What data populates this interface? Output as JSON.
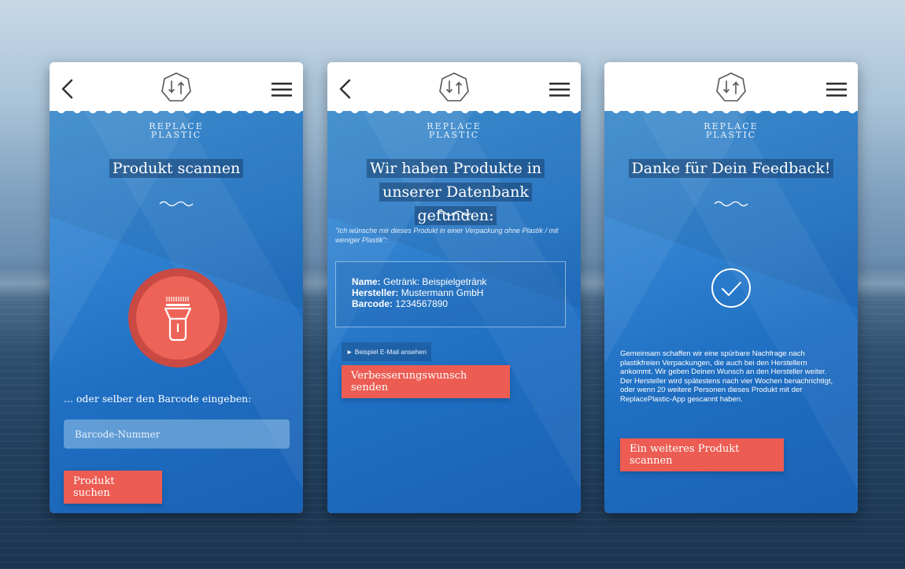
{
  "brand": {
    "line1": "REPLACE",
    "line2": "PLASTIC"
  },
  "screen1": {
    "title": "Produkt scannen",
    "alt_label": "... oder selber den Barcode eingeben:",
    "input_placeholder": "Barcode-Nummer",
    "button": "Produkt suchen"
  },
  "screen2": {
    "title": "Wir haben Produkte in unserer Datenbank gefunden:",
    "quote": "\"Ich wünsche mir dieses Produkt in einer Verpackung ohne Plastik / mit weniger Plastik\":",
    "product": {
      "name_label": "Name:",
      "name_value": "Getränk: Beispielgetränk",
      "maker_label": "Hersteller:",
      "maker_value": "Mustermann GmbH",
      "barcode_label": "Barcode:",
      "barcode_value": "1234567890"
    },
    "email_link": "► Beispiel E-Mail ansehen",
    "button": "Verbesserungswunsch senden"
  },
  "screen3": {
    "title": "Danke für Dein Feedback!",
    "paragraph": "Gemeinsam schaffen wir eine spürbare Nachfrage nach plastikfreien Verpackungen, die auch bei den Herstellern ankommt. Wir geben Deinen Wunsch an den Hersteller weiter. Der Hersteller wird spätestens nach vier Wochen benachrichtigt, oder wenn 20 weitere Personen dieses Produkt mit der ReplacePlastic-App gescannt haben.",
    "button": "Ein weiteres Produkt scannen"
  },
  "icons": {
    "back": "chevron-left-icon",
    "logo": "replace-plastic-logo-icon",
    "menu": "hamburger-menu-icon",
    "scanner": "barcode-scanner-icon",
    "check": "checkmark-circle-icon"
  },
  "colors": {
    "accent": "#ec5c52",
    "screen_blue": "#2f80cf",
    "scan_circle_outer": "#c94a43",
    "scan_circle_inner": "#ee6357"
  }
}
